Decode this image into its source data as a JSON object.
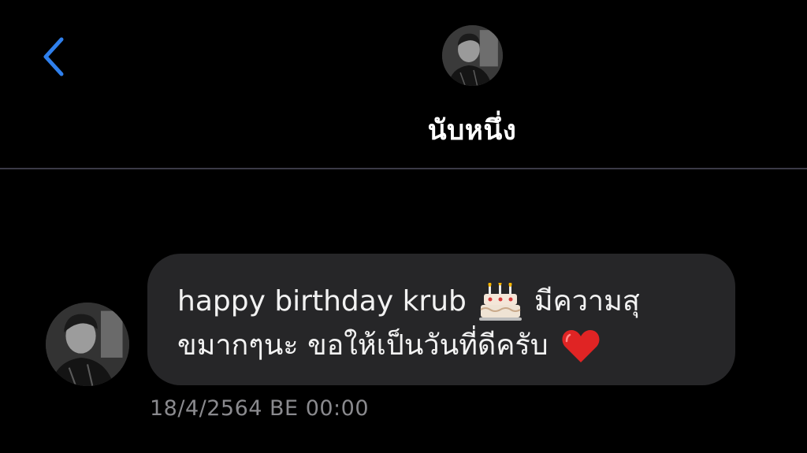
{
  "header": {
    "back_icon": "chevron-left-icon",
    "contact_name": "นับหนึ่ง",
    "avatar": "contact-photo"
  },
  "message": {
    "line1_text": "happy birthday krub",
    "line1_emoji": "birthday-cake-icon",
    "line1_tail": "มีความสุ",
    "line2_text": "ขมากๆนะ ขอให้เป็นวันที่ดีครับ",
    "line2_emoji": "red-heart-icon",
    "timestamp": "18/4/2564 BE 00:00"
  },
  "colors": {
    "background": "#000000",
    "accent": "#2f80ed",
    "bubble": "#262628",
    "timestamp": "#8a8a8e",
    "divider": "#3b3a47"
  }
}
